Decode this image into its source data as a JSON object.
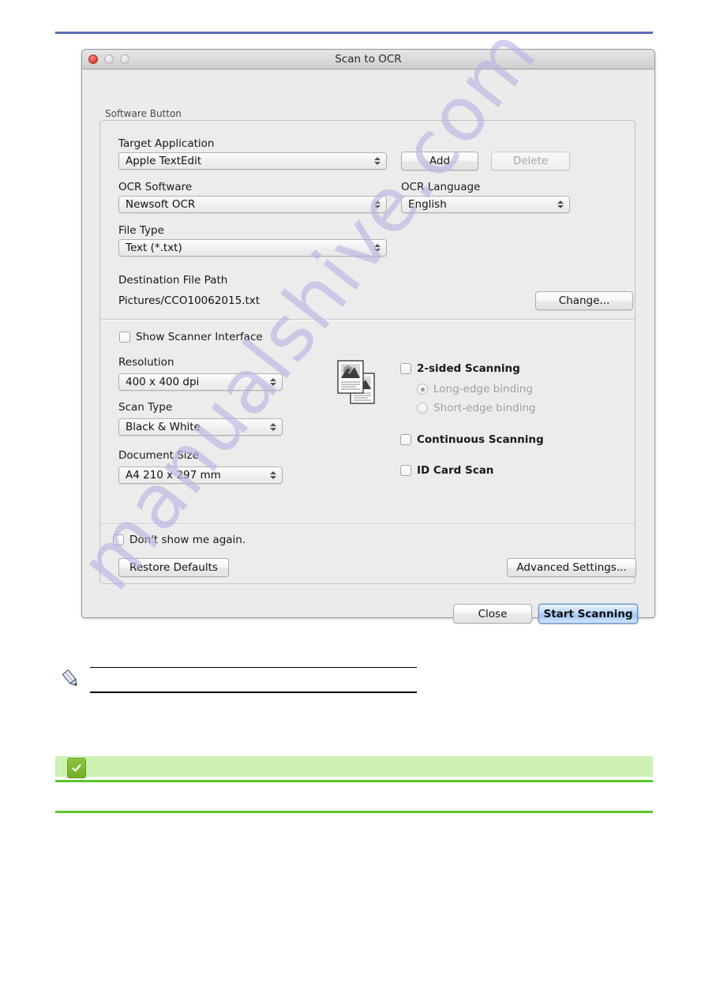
{
  "page": {
    "watermark": "manualshive.com",
    "note_icon": "pencil-icon",
    "check_badge_icon": "checkmark-icon"
  },
  "dialog": {
    "title": "Scan to OCR",
    "traffic_lights": [
      "close",
      "minimize",
      "zoom"
    ],
    "group_label": "Software Button",
    "fields": {
      "target_application": {
        "label": "Target Application",
        "value": "Apple TextEdit"
      },
      "ocr_software": {
        "label": "OCR Software",
        "value": "Newsoft OCR"
      },
      "ocr_language": {
        "label": "OCR Language",
        "value": "English"
      },
      "file_type": {
        "label": "File Type",
        "value": "Text (*.txt)"
      },
      "destination_file_path": {
        "label": "Destination File Path",
        "value": "Pictures/CCO10062015.txt"
      },
      "resolution": {
        "label": "Resolution",
        "value": "400 x 400 dpi"
      },
      "scan_type": {
        "label": "Scan Type",
        "value": "Black & White"
      },
      "document_size": {
        "label": "Document Size",
        "value": "A4 210 x 297 mm"
      }
    },
    "buttons": {
      "add": "Add",
      "delete": "Delete",
      "change": "Change...",
      "restore_defaults": "Restore Defaults",
      "advanced_settings": "Advanced Settings...",
      "close": "Close",
      "start_scanning": "Start Scanning"
    },
    "checkboxes": {
      "show_scanner_interface": "Show Scanner Interface",
      "two_sided_scanning": "2-sided Scanning",
      "continuous_scanning": "Continuous Scanning",
      "id_card_scan": "ID Card Scan",
      "dont_show_again": "Don't show me again."
    },
    "radios": {
      "long_edge": "Long-edge binding",
      "short_edge": "Short-edge binding"
    }
  },
  "colors": {
    "accent_rule": "#5b6cb5",
    "green_rule": "#5cc42c",
    "green_banner": "#cdf0b3",
    "default_button": "#9ec6f2",
    "watermark": "#b9b2e2"
  }
}
